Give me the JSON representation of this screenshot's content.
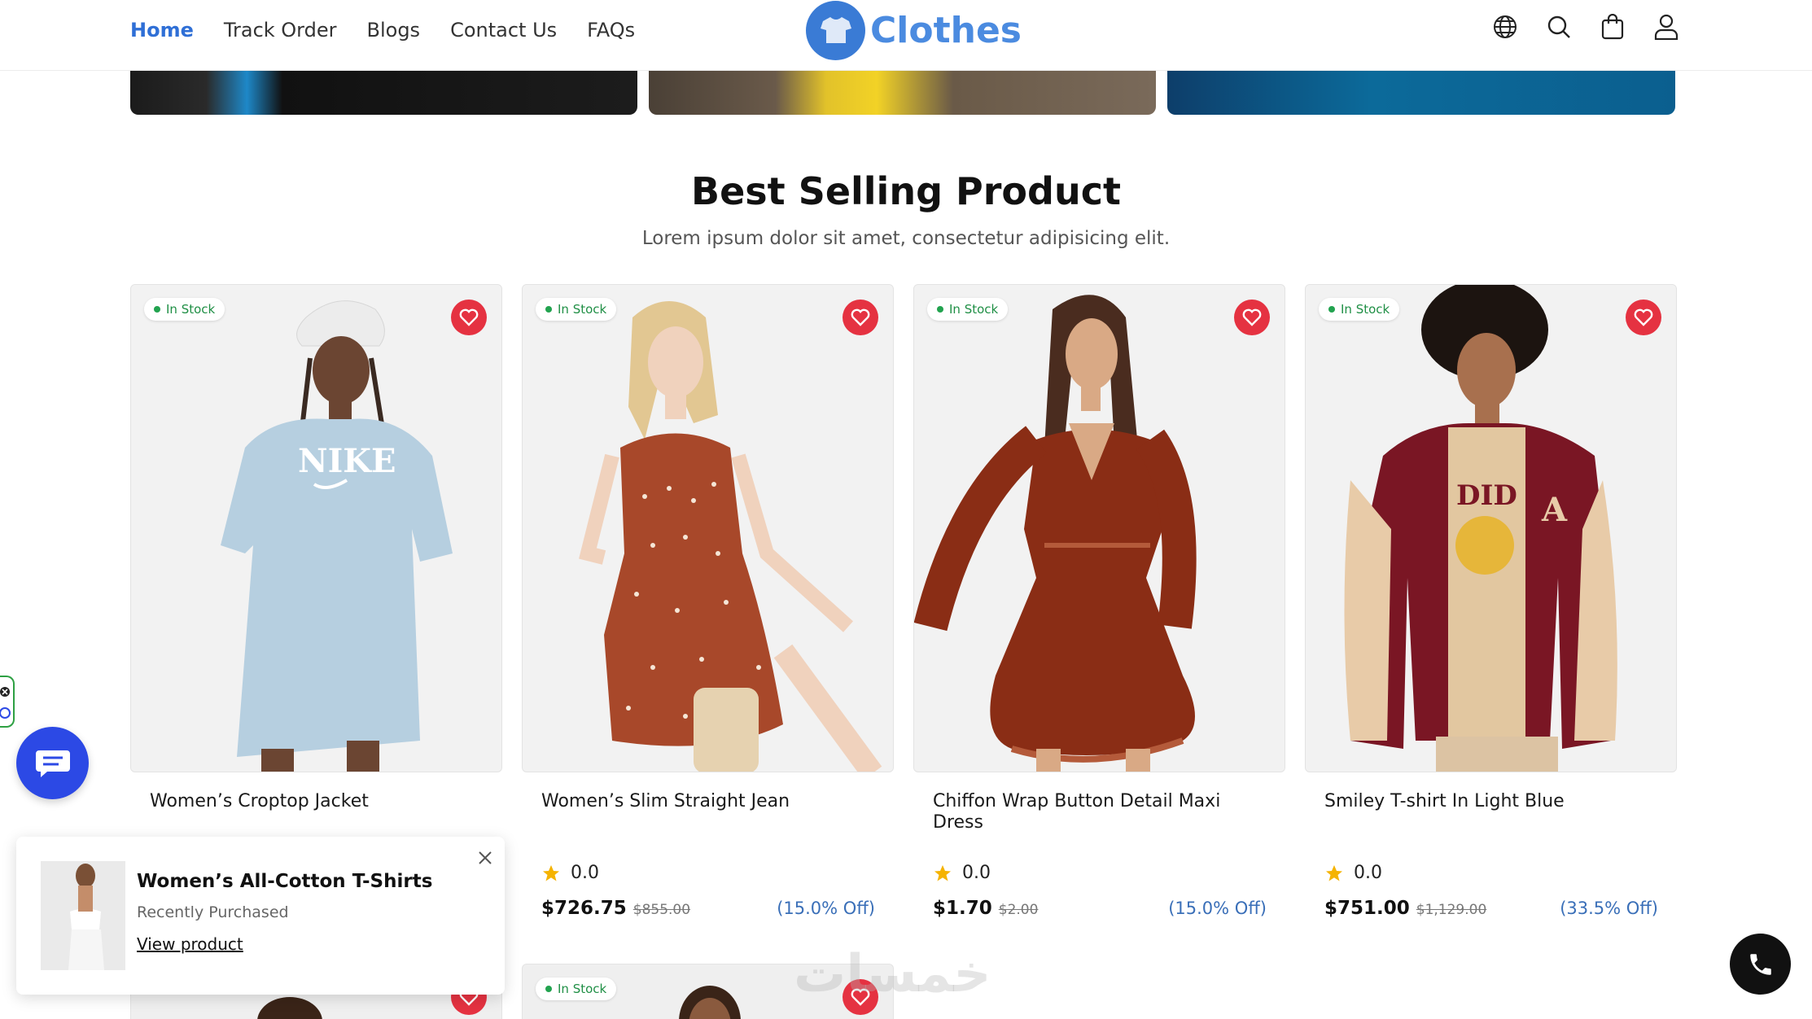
{
  "header": {
    "nav": [
      "Home",
      "Track Order",
      "Blogs",
      "Contact Us",
      "FAQs"
    ],
    "active_nav": "Home",
    "logo_text": "Clothes",
    "icons": [
      "globe-icon",
      "search-icon",
      "shopping-bag-icon",
      "user-icon"
    ]
  },
  "section": {
    "title": "Best Selling Product",
    "subtitle": "Lorem ipsum dolor sit amet, consectetur adipisicing elit."
  },
  "products": [
    {
      "stock": "In Stock",
      "name": "Women’s Croptop Jacket",
      "rating": "",
      "price": "",
      "old_price": "",
      "discount": ""
    },
    {
      "stock": "In Stock",
      "name": "Women’s Slim Straight Jean",
      "rating": "0.0",
      "price": "$726.75",
      "old_price": "$855.00",
      "discount": "(15.0% Off)"
    },
    {
      "stock": "In Stock",
      "name": "Chiffon Wrap Button Detail Maxi Dress",
      "rating": "0.0",
      "price": "$1.70",
      "old_price": "$2.00",
      "discount": "(15.0% Off)"
    },
    {
      "stock": "In Stock",
      "name": "Smiley T-shirt In Light Blue",
      "rating": "0.0",
      "price": "$751.00",
      "old_price": "$1,129.00",
      "discount": "(33.5% Off)"
    }
  ],
  "second_row": {
    "stock": "In Stock"
  },
  "popup": {
    "title": "Women’s All-Cotton T-Shirts",
    "subtitle": "Recently Purchased",
    "link": "View product"
  },
  "watermark": "خمسات",
  "colors": {
    "accent": "#2f6fd6",
    "heart": "#e53241",
    "stock": "#1f8f45",
    "chat": "#2c49e5",
    "discount": "#3a6fb8"
  }
}
